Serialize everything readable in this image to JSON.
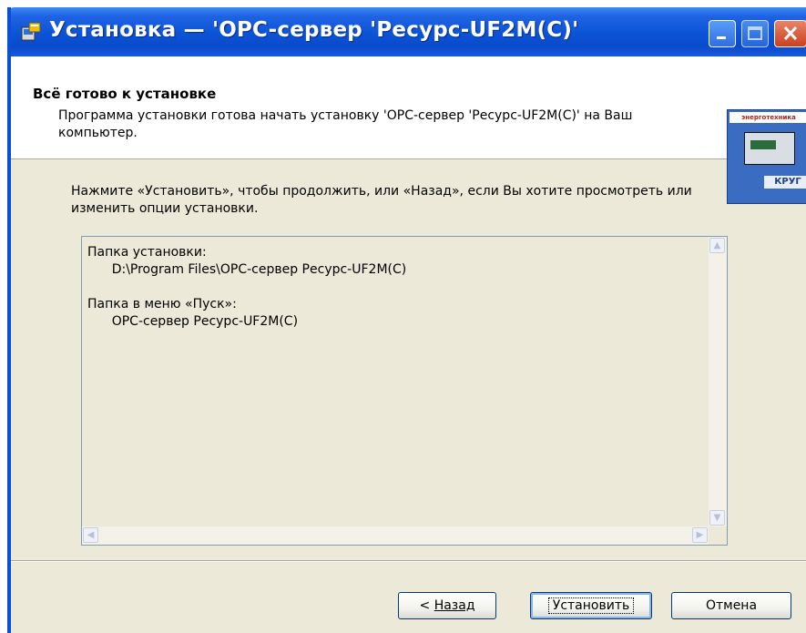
{
  "window": {
    "title": "Установка — 'OPC-сервер 'Ресурс-UF2M(C)'",
    "buttons": {
      "minimize": "minimize-icon",
      "maximize": "maximize-icon",
      "close": "close-icon"
    }
  },
  "header": {
    "title": "Всё готово к установке",
    "description": "Программа установки готова начать установку 'OPC-сервер 'Ресурс-UF2M(C)' на Ваш компьютер.",
    "logo": {
      "top_text": "энерготехника",
      "bottom_text": "КРУГ"
    }
  },
  "content": {
    "instruction": "Нажмите «Установить», чтобы продолжить, или «Назад», если Вы хотите просмотреть или изменить опции установки.",
    "memo_text": "Папка установки:\n      D:\\Program Files\\OPC-сервер Ресурс-UF2M(C)\n\nПапка в меню «Пуск»:\n      OPC-сервер Ресурс-UF2M(C)"
  },
  "buttons": {
    "back_prefix": "< ",
    "back_label": "Назад",
    "install_label": "Установить",
    "cancel_label": "Отмена"
  },
  "colors": {
    "titlebar": "#0b53d6",
    "face": "#ece9d8",
    "close": "#c9401d"
  }
}
